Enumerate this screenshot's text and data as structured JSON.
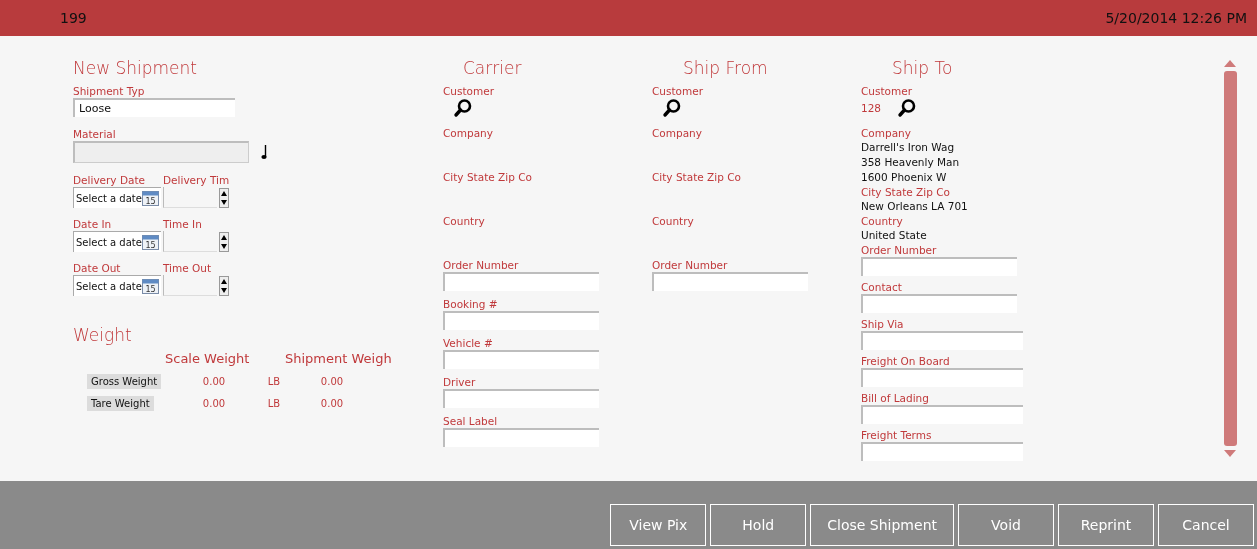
{
  "header": {
    "number": "199",
    "datetime": "5/20/2014 12:26 PM"
  },
  "new_shipment": {
    "title": "New Shipment",
    "shipment_type": {
      "label": "Shipment Typ",
      "value": "Loose"
    },
    "material": {
      "label": "Material",
      "disabled": true
    },
    "schedule": [
      {
        "date_label": "Delivery Date",
        "time_label": "Delivery Tim",
        "placeholder": "Select a date",
        "calendar_day": "15"
      },
      {
        "date_label": "Date In",
        "time_label": "Time In",
        "placeholder": "Select a date",
        "calendar_day": "15"
      },
      {
        "date_label": "Date Out",
        "time_label": "Time Out",
        "placeholder": "Select a date",
        "calendar_day": "15"
      }
    ]
  },
  "weight": {
    "title": "Weight",
    "columns": [
      "Scale Weight",
      "Shipment Weigh"
    ],
    "rows": [
      {
        "label": "Gross Weight",
        "scale": "0.00",
        "unit": "LB",
        "shipment": "0.00"
      },
      {
        "label": "Tare Weight",
        "scale": "0.00",
        "unit": "LB",
        "shipment": "0.00"
      }
    ]
  },
  "parties": [
    {
      "title": "Carrier",
      "items": [
        {
          "kind": "lookup",
          "label": "Customer"
        },
        {
          "kind": "info",
          "label": "Company"
        },
        {
          "kind": "info",
          "label": "City State Zip Co"
        },
        {
          "kind": "info",
          "label": "Country"
        },
        {
          "kind": "input",
          "label": "Order Number"
        },
        {
          "kind": "input",
          "label": "Booking #"
        },
        {
          "kind": "input",
          "label": "Vehicle #"
        },
        {
          "kind": "input",
          "label": "Driver"
        },
        {
          "kind": "input",
          "label": "Seal Label"
        }
      ]
    },
    {
      "title": "Ship From",
      "items": [
        {
          "kind": "lookup",
          "label": "Customer"
        },
        {
          "kind": "info",
          "label": "Company"
        },
        {
          "kind": "info",
          "label": "City State Zip Co"
        },
        {
          "kind": "info",
          "label": "Country"
        },
        {
          "kind": "input",
          "label": "Order Number"
        }
      ]
    },
    {
      "title": "Ship To",
      "items": [
        {
          "kind": "lookup",
          "label": "Customer",
          "value": "128"
        },
        {
          "kind": "info",
          "label": "Company",
          "lines": [
            "Darrell's Iron Wag",
            "358 Heavenly Man",
            "1600 Phoenix W"
          ]
        },
        {
          "kind": "info",
          "label": "City State Zip Co",
          "lines": [
            "New Orleans LA 701"
          ]
        },
        {
          "kind": "info",
          "label": "Country",
          "lines": [
            "United State"
          ]
        },
        {
          "kind": "input",
          "label": "Order Number"
        },
        {
          "kind": "input",
          "label": "Contact"
        },
        {
          "kind": "input",
          "label": "Ship Via"
        },
        {
          "kind": "input",
          "label": "Freight On Board"
        },
        {
          "kind": "input",
          "label": "Bill of Lading"
        },
        {
          "kind": "input",
          "label": "Freight Terms"
        }
      ]
    }
  ],
  "buttons": [
    "View Pix",
    "Hold",
    "Close Shipment",
    "Void",
    "Reprint",
    "Cancel"
  ]
}
